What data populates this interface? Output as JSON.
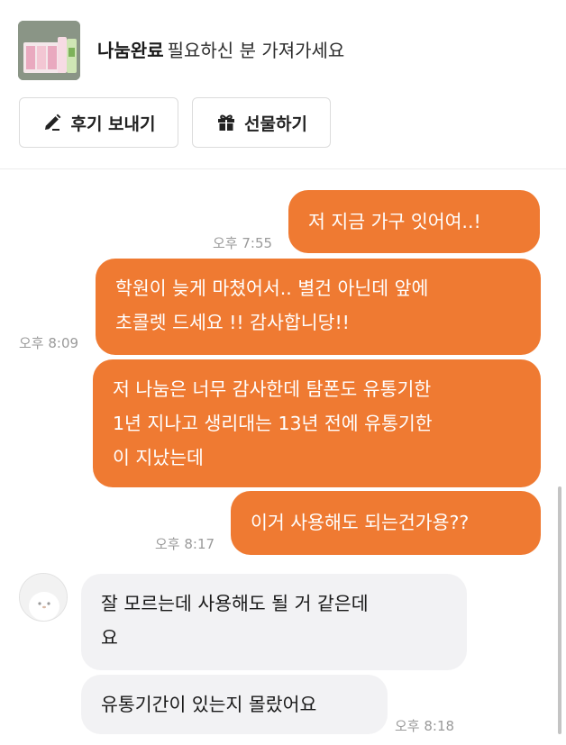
{
  "header": {
    "product_status": "나눔완료",
    "product_title": "필요하신 분 가져가세요",
    "review_button_label": "후기 보내기",
    "gift_button_label": "선물하기",
    "review_icon": "pencil-icon",
    "gift_icon": "gift-icon"
  },
  "messages": [
    {
      "direction": "outgoing",
      "lines": [
        "저 지금 가구 잇어여..!"
      ],
      "time": "오후 7:55"
    },
    {
      "direction": "outgoing",
      "lines": [
        "학원이 늦게 마쳤어서.. 별건 아닌데 앞에",
        "초콜렛 드세요 !! 감사합니당!!"
      ],
      "time": "오후 8:09"
    },
    {
      "direction": "outgoing",
      "lines": [
        "저 나눔은 너무 감사한데 탐폰도 유통기한",
        "1년 지나고 생리대는 13년 전에 유통기한",
        "이 지났는데"
      ],
      "time": ""
    },
    {
      "direction": "outgoing",
      "lines": [
        "이거 사용해도 되는건가용??"
      ],
      "time": "오후 8:17"
    },
    {
      "direction": "incoming",
      "lines": [
        "잘 모르는데 사용해도 될 거 같은데",
        "요"
      ],
      "time": ""
    },
    {
      "direction": "incoming",
      "lines": [
        "유통기간이 있는지 몰랐어요"
      ],
      "time": "오후 8:18"
    }
  ],
  "colors": {
    "outgoing_bubble": "#ef7a32",
    "incoming_bubble": "#f2f2f4",
    "timestamp": "#9a9a9a"
  }
}
